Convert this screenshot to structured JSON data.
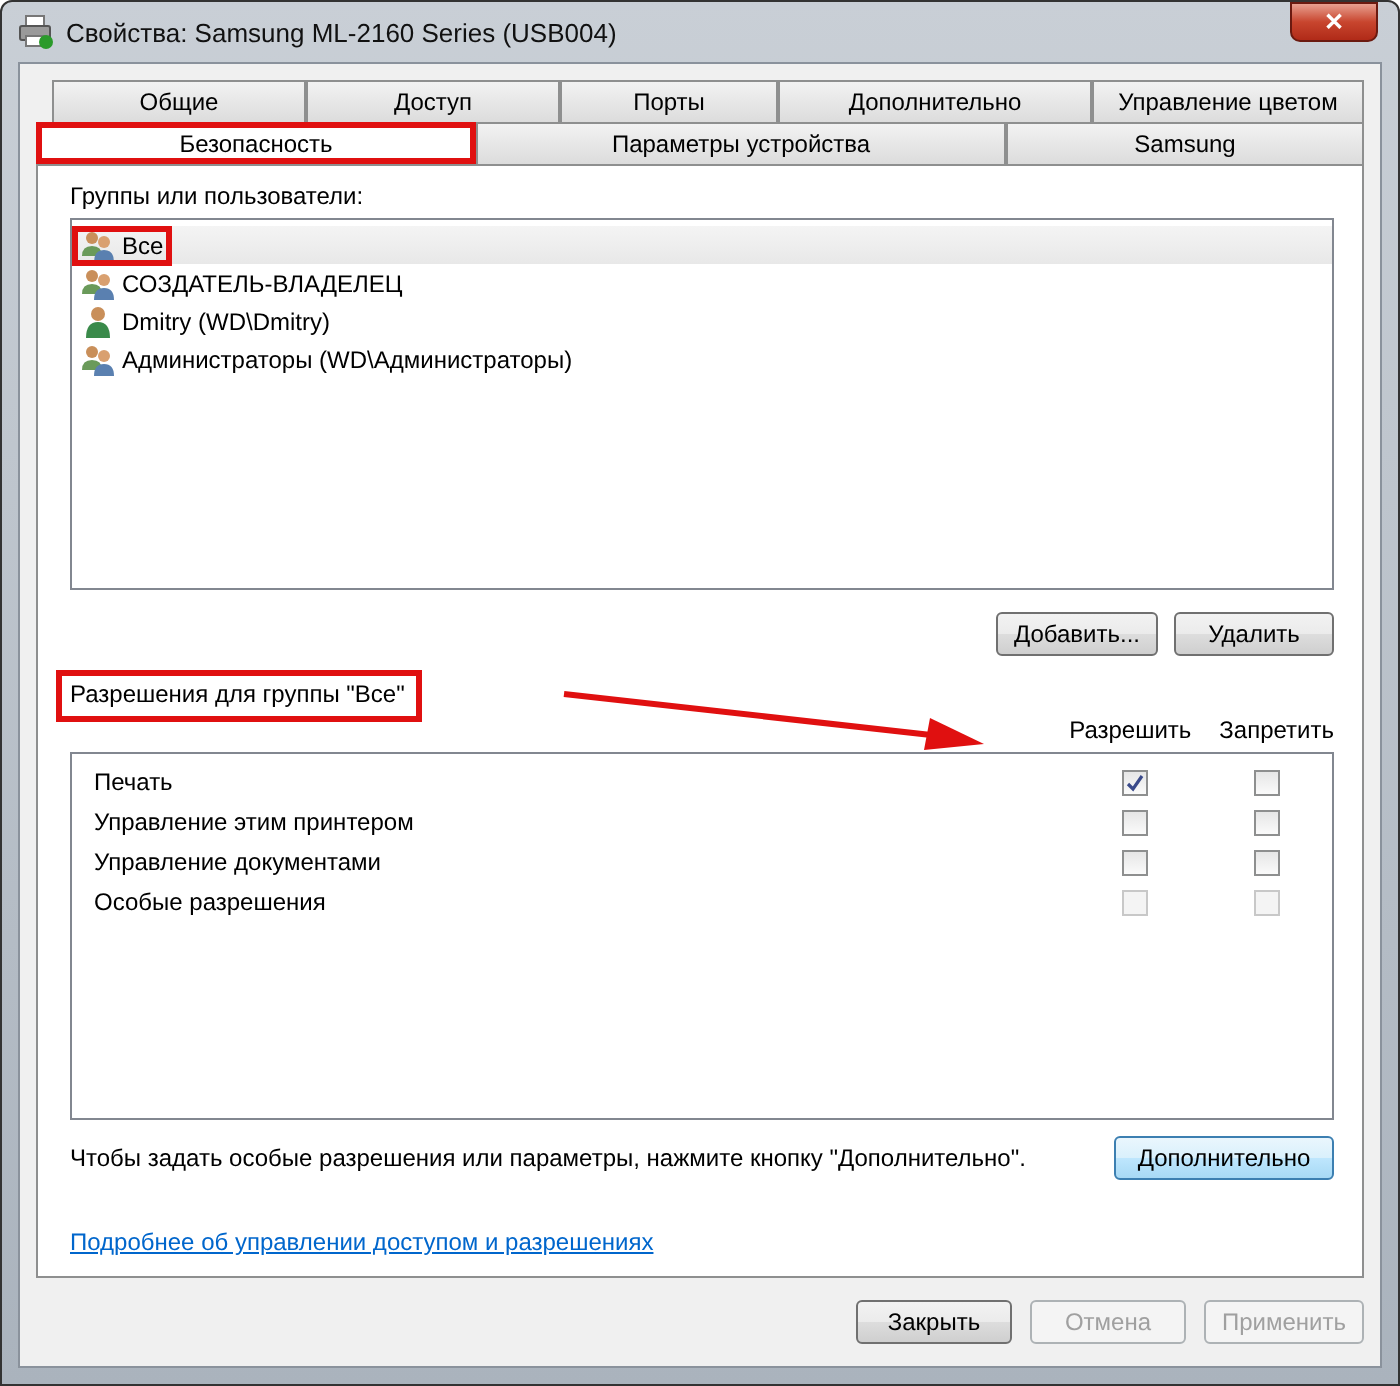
{
  "window": {
    "title": "Свойства: Samsung ML-2160 Series (USB004)",
    "close": "✕"
  },
  "tabs_row_1": [
    {
      "label": "Общие",
      "selected": false
    },
    {
      "label": "Доступ",
      "selected": false
    },
    {
      "label": "Порты",
      "selected": false
    },
    {
      "label": "Дополнительно",
      "selected": false
    },
    {
      "label": "Управление цветом",
      "selected": false
    }
  ],
  "tabs_row_2": [
    {
      "label": "Безопасность",
      "selected": true,
      "highlighted": true
    },
    {
      "label": "Параметры устройства",
      "selected": false,
      "highlighted": false
    },
    {
      "label": "Samsung",
      "selected": false,
      "highlighted": false
    }
  ],
  "groups_label": "Группы или пользователи:",
  "users": [
    {
      "name": "Все",
      "kind": "group",
      "selected": true,
      "highlighted": true
    },
    {
      "name": "СОЗДАТЕЛЬ-ВЛАДЕЛЕЦ",
      "kind": "group",
      "selected": false,
      "highlighted": false
    },
    {
      "name": "Dmitry (WD\\Dmitry)",
      "kind": "user",
      "selected": false,
      "highlighted": false
    },
    {
      "name": "Администраторы (WD\\Администраторы)",
      "kind": "group",
      "selected": false,
      "highlighted": false
    }
  ],
  "user_buttons": [
    "Добавить...",
    "Удалить"
  ],
  "permissions_label": {
    "text": "Разрешения для группы \"Все\"",
    "highlighted": true
  },
  "annotation_arrow": true,
  "permission_columns": [
    "Разрешить",
    "Запретить"
  ],
  "permissions": [
    {
      "name": "Печать",
      "allow": true,
      "deny": false,
      "disabled": false
    },
    {
      "name": "Управление этим принтером",
      "allow": false,
      "deny": false,
      "disabled": false
    },
    {
      "name": "Управление документами",
      "allow": false,
      "deny": false,
      "disabled": false
    },
    {
      "name": "Особые разрешения",
      "allow": false,
      "deny": false,
      "disabled": true
    }
  ],
  "advanced_hint": "Чтобы задать особые разрешения или параметры, нажмите кнопку \"Дополнительно\".",
  "advanced_button": "Дополнительно",
  "help_link": "Подробнее об управлении доступом и разрешениях",
  "footer_buttons": [
    {
      "label": "Закрыть",
      "disabled": false
    },
    {
      "label": "Отмена",
      "disabled": true
    },
    {
      "label": "Применить",
      "disabled": true
    }
  ]
}
